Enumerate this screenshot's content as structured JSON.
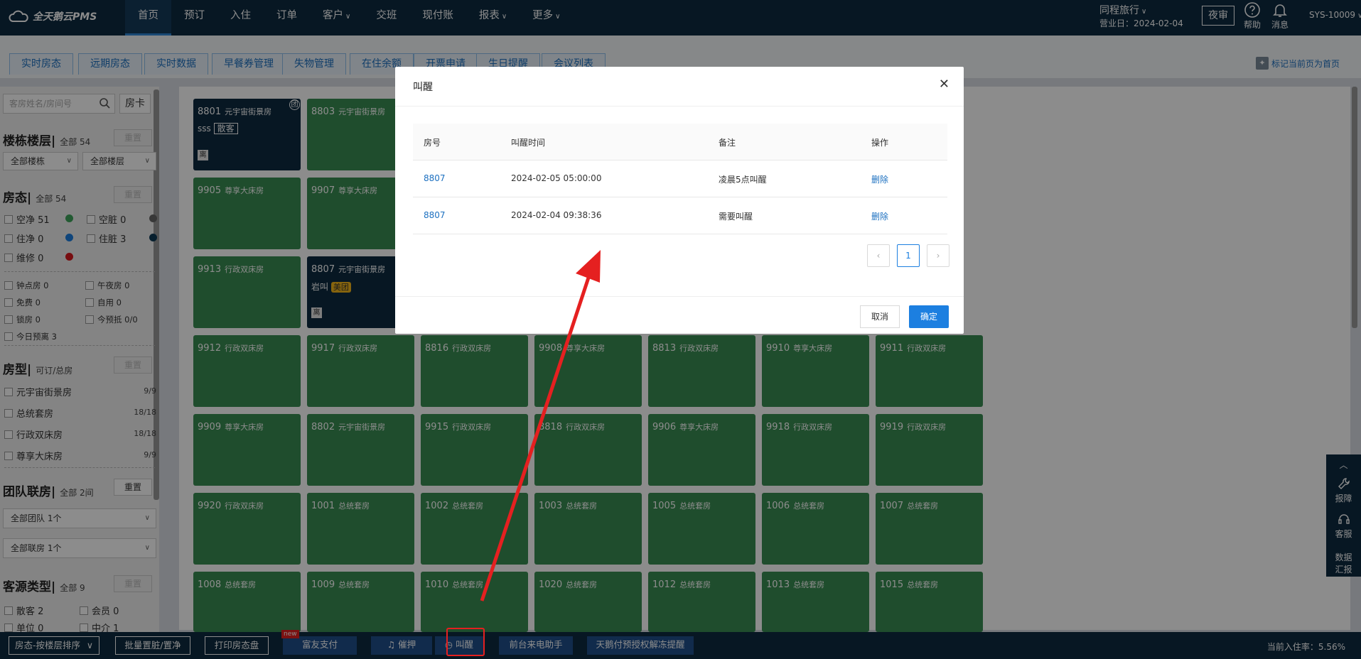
{
  "app": {
    "logo_text": "全天鹅云PMS"
  },
  "nav": {
    "items": [
      {
        "label": "首页",
        "active": true,
        "caret": false
      },
      {
        "label": "预订",
        "caret": false
      },
      {
        "label": "入住",
        "caret": false
      },
      {
        "label": "订单",
        "caret": false
      },
      {
        "label": "客户",
        "caret": true
      },
      {
        "label": "交班",
        "caret": false
      },
      {
        "label": "现付账",
        "caret": false
      },
      {
        "label": "报表",
        "caret": true
      },
      {
        "label": "更多",
        "caret": true
      }
    ]
  },
  "header_right": {
    "org": "同程旅行",
    "business_date": "营业日：2024-02-04",
    "night_audit": "夜审",
    "help": "帮助",
    "messages": "消息",
    "user": "SYS-10009"
  },
  "subtabs": [
    "实时房态",
    "远期房态",
    "实时数据",
    "早餐券管理",
    "失物管理",
    "在住余额",
    "开票申请",
    "生日提醒",
    "会议列表"
  ],
  "mark_home": "标记当前页为首页",
  "sidebar": {
    "search_placeholder": "客房姓名/房间号",
    "room_card": "房卡",
    "building": {
      "title": "楼栋楼层",
      "total": "全部 54",
      "reset": "重置",
      "sel1": "全部楼栋",
      "sel2": "全部楼层"
    },
    "status": {
      "title": "房态",
      "total": "全部 54",
      "reset": "重置",
      "items": [
        {
          "label": "空净 51",
          "color": "#3fa55b"
        },
        {
          "label": "空脏 0",
          "color": "#666666"
        },
        {
          "label": "住净 0",
          "color": "#1c7fe0"
        },
        {
          "label": "住脏 3",
          "color": "#0d3a55"
        },
        {
          "label": "维修 0",
          "color": "#d9181e"
        }
      ]
    },
    "flags": [
      "钟点房 0",
      "午夜房 0",
      "免费 0",
      "自用 0",
      "锁房 0",
      "今预抵 0/0",
      "今日预离 3"
    ],
    "roomtype": {
      "title": "房型",
      "total": "可订/总房",
      "reset": "重置",
      "items": [
        {
          "label": "元宇宙街景房",
          "count": "9/9"
        },
        {
          "label": "总统套房",
          "count": "18/18"
        },
        {
          "label": "行政双床房",
          "count": "18/18"
        },
        {
          "label": "尊享大床房",
          "count": "9/9"
        }
      ]
    },
    "team": {
      "title": "团队联房",
      "total": "全部 2间",
      "reset": "重置",
      "sel1": "全部团队 1个",
      "sel2": "全部联房 1个"
    },
    "source": {
      "title": "客源类型",
      "total": "全部 9",
      "reset": "重置",
      "items": [
        "散客 2",
        "会员 0",
        "单位 0",
        "中介 1"
      ]
    }
  },
  "rooms": [
    {
      "no": "8801",
      "type": "元宇宙街景房",
      "guest": "sss",
      "tag": "散客",
      "dark": true,
      "team": "团",
      "leave": "离"
    },
    {
      "no": "8803",
      "type": "元宇宙街景房"
    },
    {
      "no": "9905",
      "type": "尊享大床房"
    },
    {
      "no": "9907",
      "type": "尊享大床房"
    },
    {
      "no": "9913",
      "type": "行政双床房"
    },
    {
      "no": "8807",
      "type": "元宇宙街景房",
      "guest": "岩叫",
      "badge": "美团",
      "dark": true,
      "leave": "离"
    },
    {
      "no": "9912",
      "type": "行政双床房"
    },
    {
      "no": "9917",
      "type": "行政双床房"
    },
    {
      "no": "8816",
      "type": "行政双床房"
    },
    {
      "no": "9908",
      "type": "尊享大床房"
    },
    {
      "no": "8813",
      "type": "行政双床房"
    },
    {
      "no": "9910",
      "type": "尊享大床房"
    },
    {
      "no": "9911",
      "type": "行政双床房"
    },
    {
      "no": "9909",
      "type": "尊享大床房"
    },
    {
      "no": "8802",
      "type": "元宇宙街景房"
    },
    {
      "no": "9915",
      "type": "行政双床房"
    },
    {
      "no": "8818",
      "type": "行政双床房"
    },
    {
      "no": "9906",
      "type": "尊享大床房"
    },
    {
      "no": "9918",
      "type": "行政双床房"
    },
    {
      "no": "9919",
      "type": "行政双床房"
    },
    {
      "no": "9920",
      "type": "行政双床房"
    },
    {
      "no": "1001",
      "type": "总统套房"
    },
    {
      "no": "1002",
      "type": "总统套房"
    },
    {
      "no": "1003",
      "type": "总统套房"
    },
    {
      "no": "1005",
      "type": "总统套房"
    },
    {
      "no": "1006",
      "type": "总统套房"
    },
    {
      "no": "1007",
      "type": "总统套房"
    },
    {
      "no": "1008",
      "type": "总统套房"
    },
    {
      "no": "1009",
      "type": "总统套房"
    },
    {
      "no": "1010",
      "type": "总统套房"
    },
    {
      "no": "1020",
      "type": "总统套房"
    },
    {
      "no": "1012",
      "type": "总统套房"
    },
    {
      "no": "1013",
      "type": "总统套房"
    },
    {
      "no": "1015",
      "type": "总统套房"
    }
  ],
  "bottom": {
    "sort": "房态-按楼层排序",
    "buttons": [
      "批量置脏/置净",
      "打印房态盘",
      "富友支付",
      "催押",
      "叫醒",
      "前台来电助手",
      "天鹅付预授权解冻提醒"
    ],
    "new_tag": "new",
    "occupancy": "当前入住率：5.56%"
  },
  "float_panel": [
    "报障",
    "客服",
    "数据",
    "汇报"
  ],
  "modal": {
    "title": "叫醒",
    "columns": [
      "房号",
      "叫醒时间",
      "备注",
      "操作"
    ],
    "rows": [
      {
        "room": "8807",
        "time": "2024-02-05 05:00:00",
        "note": "凌晨5点叫醒",
        "action": "删除"
      },
      {
        "room": "8807",
        "time": "2024-02-04 09:38:36",
        "note": "需要叫醒",
        "action": "删除"
      }
    ],
    "page": "1",
    "cancel": "取消",
    "confirm": "确定"
  }
}
